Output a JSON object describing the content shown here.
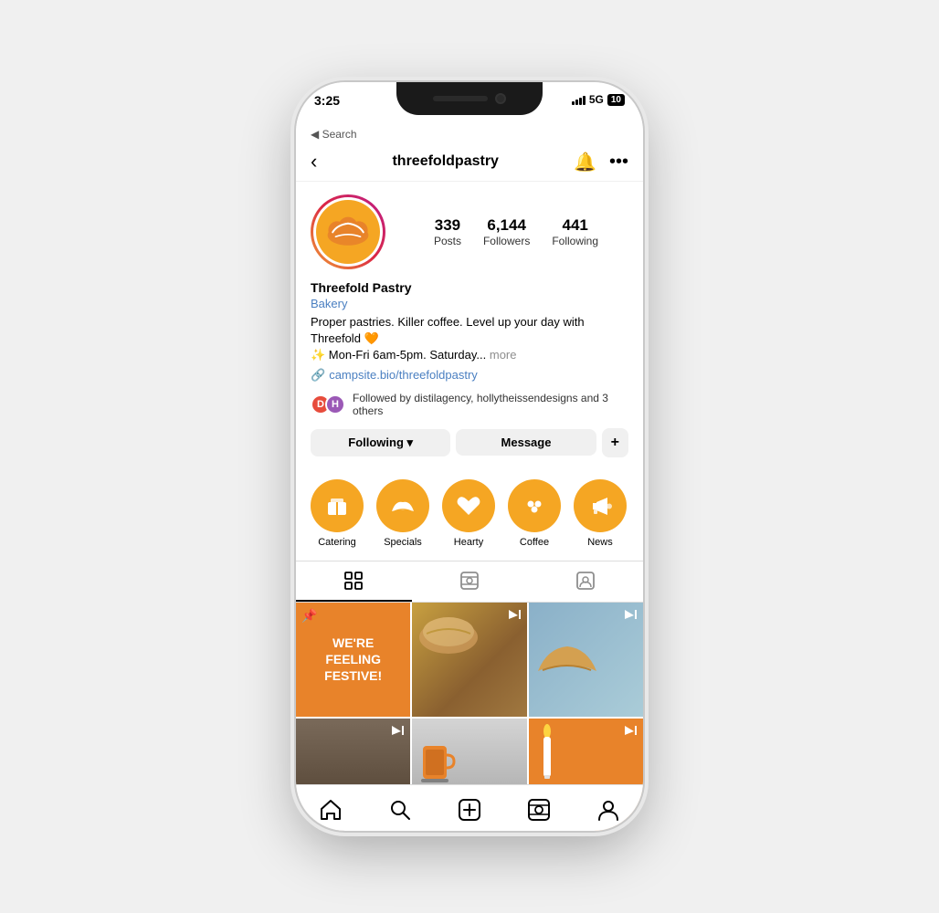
{
  "phone": {
    "status_bar": {
      "time": "3:25",
      "signal": "5G",
      "battery": "10"
    },
    "search_back": "◀ Search"
  },
  "header": {
    "back_icon": "‹",
    "username": "threefoldpastry",
    "bell_icon": "🔔",
    "more_icon": "···"
  },
  "profile": {
    "name": "Threefold Pastry",
    "category": "Bakery",
    "bio_line1": "Proper pastries. Killer coffee. Level up your day with",
    "bio_line2": "Threefold 🧡",
    "bio_line3": "✨ Mon-Fri 6am-5pm. Saturday...",
    "more_label": "more",
    "link": "campsite.bio/threefoldpastry",
    "followed_by_text": "Followed by distilagency, hollytheissendesigns and 3 others",
    "stats": {
      "posts_count": "339",
      "posts_label": "Posts",
      "followers_count": "6,144",
      "followers_label": "Followers",
      "following_count": "441",
      "following_label": "Following"
    }
  },
  "actions": {
    "following_label": "Following ▾",
    "message_label": "Message",
    "add_label": "+"
  },
  "highlights": [
    {
      "icon": "📦",
      "label": "Catering"
    },
    {
      "icon": "🥐",
      "label": "Specials"
    },
    {
      "icon": "❤️",
      "label": "Hearty"
    },
    {
      "icon": "☕",
      "label": "Coffee"
    },
    {
      "icon": "📢",
      "label": "News"
    }
  ],
  "tabs": {
    "grid_icon": "⊞",
    "reel_icon": "▶",
    "tag_icon": "◻"
  },
  "grid_posts": [
    {
      "type": "orange_text",
      "text": "WE'RE FEELING\nFESTIVE!",
      "has_pin": true
    },
    {
      "type": "bread",
      "text": "",
      "has_video": true
    },
    {
      "type": "croissant",
      "text": "",
      "has_video": true
    },
    {
      "type": "coffee_hands",
      "text": "",
      "has_video": true
    },
    {
      "type": "coffee_cup",
      "text": "",
      "has_video": false
    },
    {
      "type": "candle_orange",
      "text": "",
      "has_video": true
    }
  ],
  "bottom_nav": {
    "home_icon": "⌂",
    "search_icon": "🔍",
    "add_icon": "⊕",
    "reel_icon": "▶",
    "profile_icon": "👤"
  }
}
